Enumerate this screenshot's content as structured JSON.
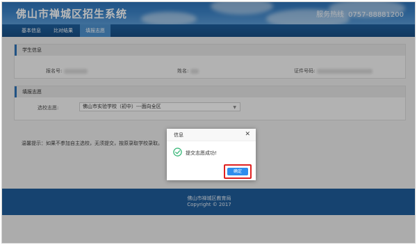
{
  "header": {
    "title": "佛山市禅城区招生系统",
    "hotline_label": "服务热线",
    "hotline_number": "0757-88881200"
  },
  "nav": {
    "items": [
      "基本信息",
      "比对结果",
      "填报志愿"
    ],
    "active_index": 2
  },
  "student_info": {
    "heading": "学生信息",
    "registration_label": "报名号:",
    "name_label": "姓名:",
    "id_label": "证件号码:"
  },
  "application": {
    "heading": "填报志愿",
    "school_label": "选校志愿:",
    "school_value": "佛山市实验学校（初中）---面向全区"
  },
  "tip": "温馨提示：如果不参加自主选校，无须提交，按原录取学校录取。",
  "footer": {
    "line1": "佛山市禅城区教育局",
    "line2": "Copyright © 2017"
  },
  "dialog": {
    "title": "信息",
    "message": "提交志愿成功!",
    "confirm_label": "确定"
  },
  "colors": {
    "header_blue": "#2f74b9",
    "nav_dark": "#1e5f9e",
    "nav_active": "#4e92cf",
    "success_green": "#3bb87a",
    "confirm_blue": "#2e8ded",
    "highlight_red": "#e02020"
  }
}
